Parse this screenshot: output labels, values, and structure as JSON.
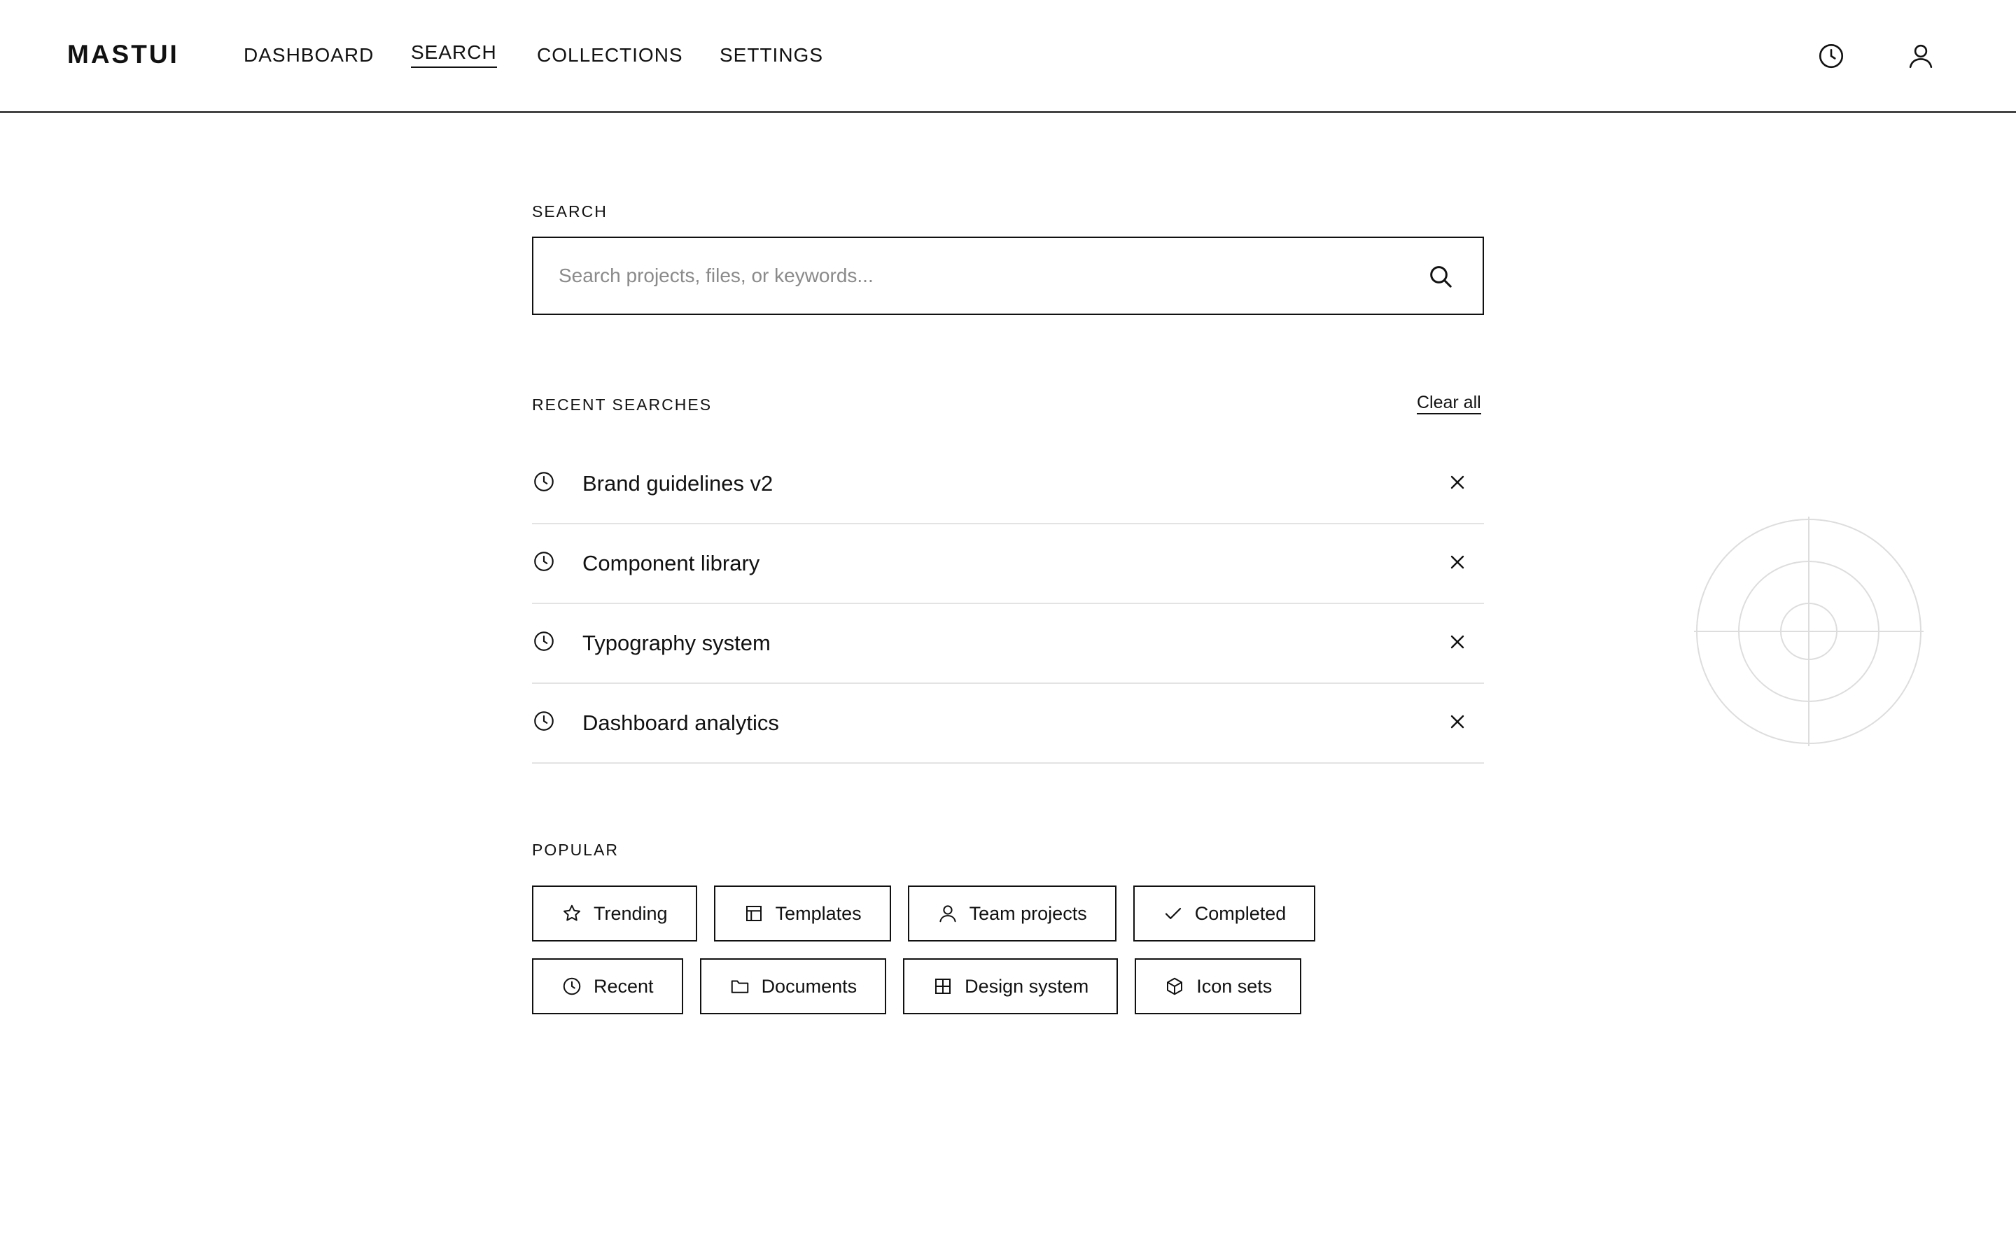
{
  "header": {
    "logo": "MASTUI",
    "nav": [
      {
        "label": "DASHBOARD"
      },
      {
        "label": "SEARCH"
      },
      {
        "label": "COLLECTIONS"
      },
      {
        "label": "SETTINGS"
      }
    ],
    "active_nav": "SEARCH",
    "icons": [
      "clock-icon",
      "user-icon"
    ]
  },
  "search": {
    "section_label": "SEARCH",
    "value": "",
    "placeholder": "Search projects, files, or keywords...",
    "icon": "search-icon"
  },
  "recent": {
    "section_label": "RECENT SEARCHES",
    "clear_label": "Clear all",
    "items": [
      {
        "label": "Brand guidelines v2"
      },
      {
        "label": "Component library"
      },
      {
        "label": "Typography system"
      },
      {
        "label": "Dashboard analytics"
      }
    ]
  },
  "popular": {
    "section_label": "POPULAR",
    "chips": [
      {
        "label": "Trending",
        "icon": "star-icon"
      },
      {
        "label": "Templates",
        "icon": "layout-icon"
      },
      {
        "label": "Team projects",
        "icon": "user-icon"
      },
      {
        "label": "Completed",
        "icon": "check-icon"
      },
      {
        "label": "Recent",
        "icon": "clock-icon"
      },
      {
        "label": "Documents",
        "icon": "folder-icon"
      },
      {
        "label": "Design system",
        "icon": "grid-icon"
      },
      {
        "label": "Icon sets",
        "icon": "cube-icon"
      }
    ]
  },
  "colors": {
    "text": "#111111",
    "background": "#ffffff",
    "divider": "#e3e3e3",
    "placeholder": "#8a8a8a",
    "decoration": "#dddddd"
  }
}
